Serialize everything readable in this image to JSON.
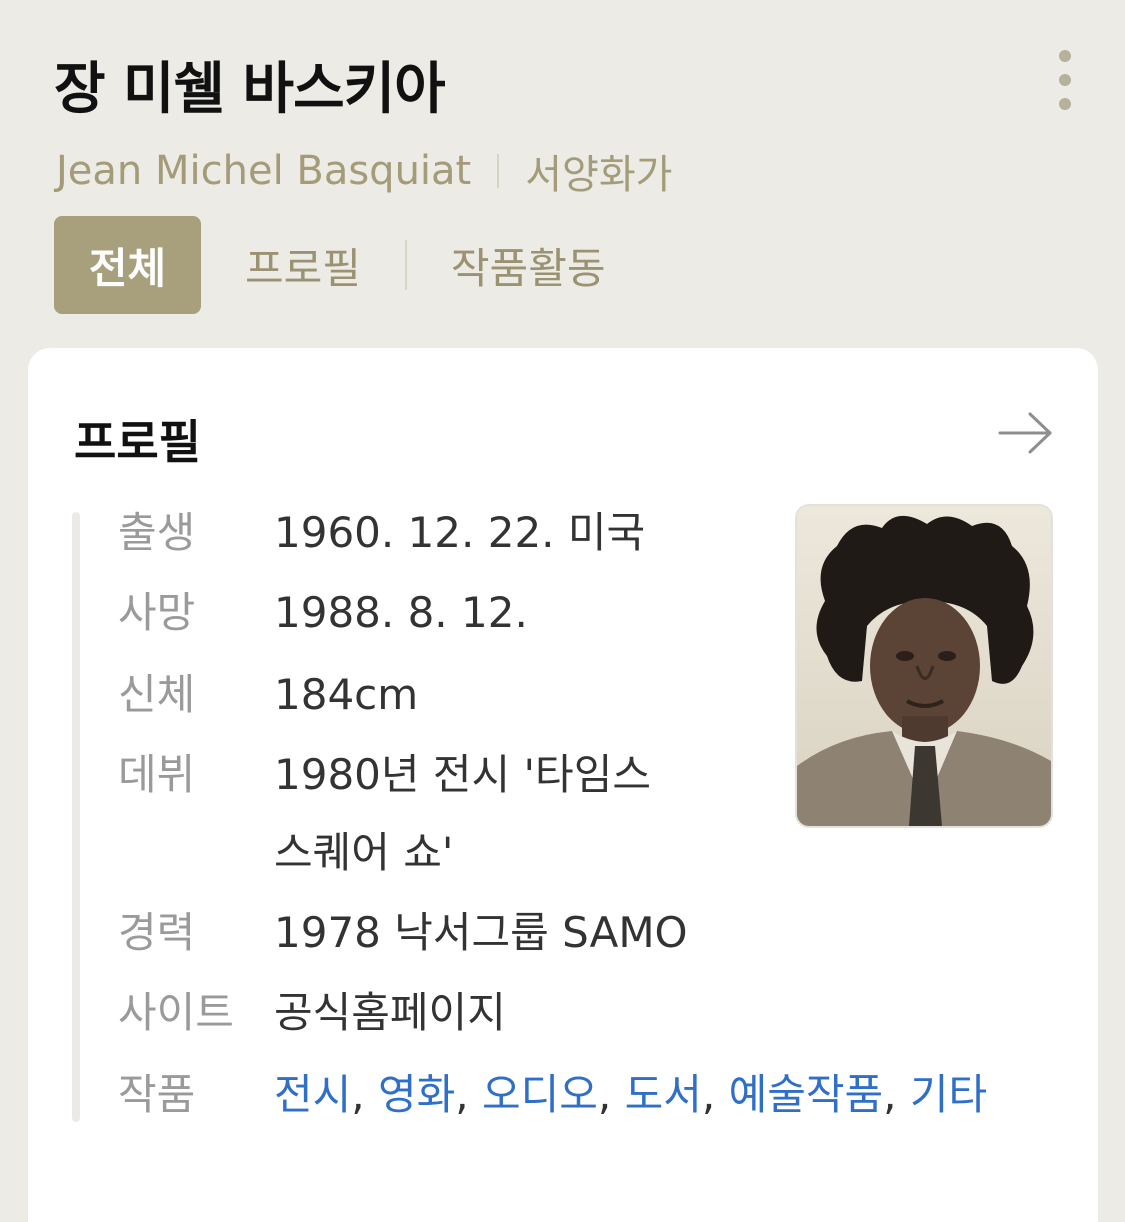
{
  "header": {
    "title": "장 미쉘 바스키아",
    "english_name": "Jean Michel Basquiat",
    "category": "서양화가",
    "more_icon": "vertical-dots-icon"
  },
  "tabs": [
    {
      "label": "전체",
      "active": true
    },
    {
      "label": "프로필",
      "active": false
    },
    {
      "label": "작품활동",
      "active": false
    }
  ],
  "profile": {
    "title": "프로필",
    "arrow_icon": "arrow-right-icon",
    "rows": {
      "birth": {
        "label": "출생",
        "value": "1960. 12. 22. 미국"
      },
      "death": {
        "label": "사망",
        "value": "1988. 8. 12."
      },
      "body": {
        "label": "신체",
        "value": "184cm"
      },
      "debut": {
        "label": "데뷔",
        "value_line1": "1980년 전시 '타임스",
        "value_line2": "스퀘어 쇼'"
      },
      "career": {
        "label": "경력",
        "value": "1978 낙서그룹 SAMO"
      },
      "site": {
        "label": "사이트",
        "link": "공식홈페이지"
      },
      "works": {
        "label": "작품",
        "links": [
          "전시",
          "영화",
          "오디오",
          "도서",
          "예술작품",
          "기타"
        ],
        "separator": ", ",
        "last_line": "타"
      }
    },
    "photo_description_icon": "portrait-photo"
  },
  "colors": {
    "background": "#ecebe6",
    "accent": "#a89f7c",
    "link": "#2f6fc8",
    "muted_text": "#9a9a9a"
  }
}
